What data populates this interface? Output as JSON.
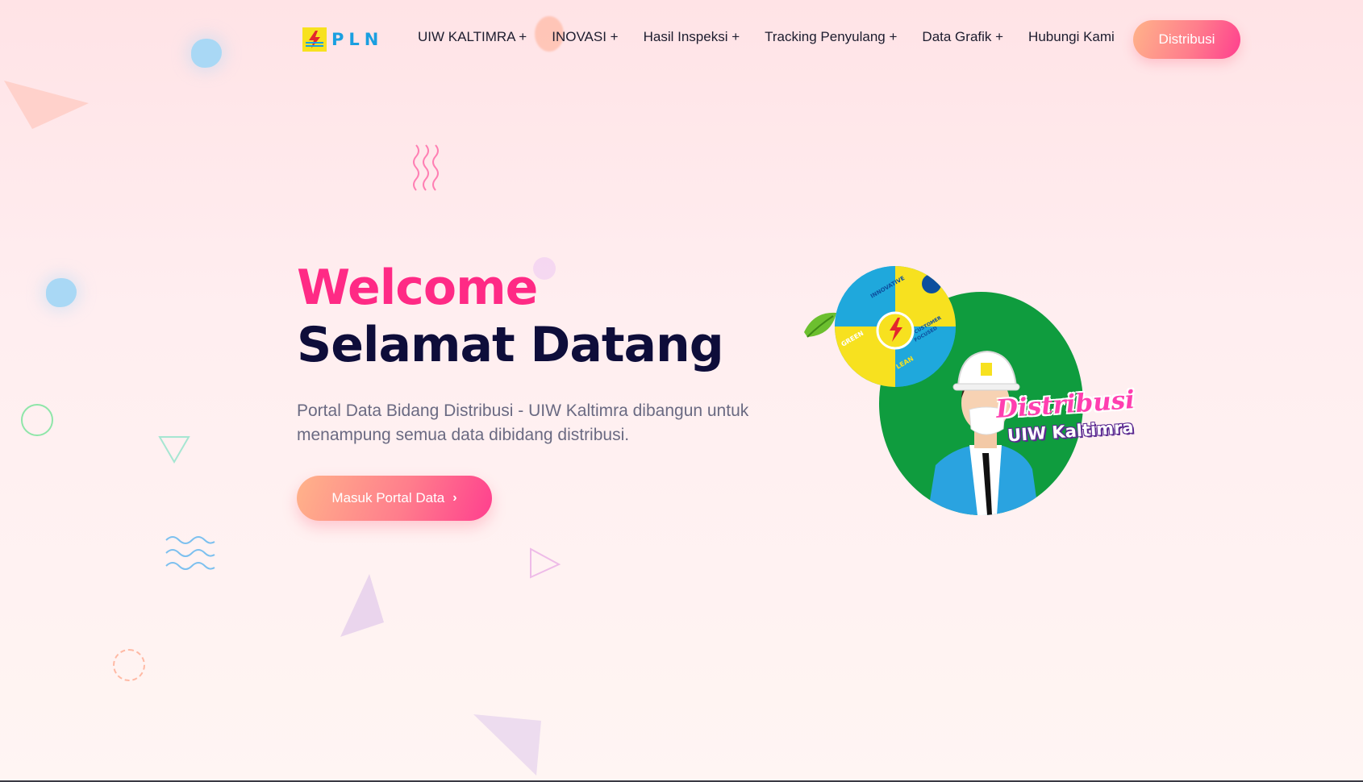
{
  "header": {
    "logo_text": "PLN",
    "logo_icon": "pln-lightning-logo",
    "nav": [
      {
        "label": "UIW KALTIMRA +"
      },
      {
        "label": "INOVASI +"
      },
      {
        "label": "Hasil Inspeksi +"
      },
      {
        "label": "Tracking Penyulang +"
      },
      {
        "label": "Data Grafik +"
      },
      {
        "label": "Hubungi Kami"
      }
    ],
    "button_label": "Distribusi"
  },
  "hero": {
    "title_line1": "Welcome",
    "title_line2": "Selamat Datang",
    "description": "Portal Data Bidang Distribusi - UIW Kaltimra dibangun untuk menampung semua data dibidang distribusi.",
    "cta_label": "Masuk Portal Data",
    "cta_icon": "chevron-right-icon"
  },
  "illustration": {
    "badge_title": "Distribusi",
    "badge_subtitle": "UIW Kaltimra",
    "puzzle_labels": [
      "INNOVATIVE",
      "GREEN",
      "CUSTOMER FOCUSED",
      "LEAN"
    ]
  },
  "colors": {
    "accent_pink": "#ff2a85",
    "heading_navy": "#0e0d3a",
    "gradient_start": "#ffb38a",
    "gradient_end": "#ff3f8e",
    "illustration_green": "#0f9c3e",
    "logo_blue": "#1a9fe0"
  }
}
